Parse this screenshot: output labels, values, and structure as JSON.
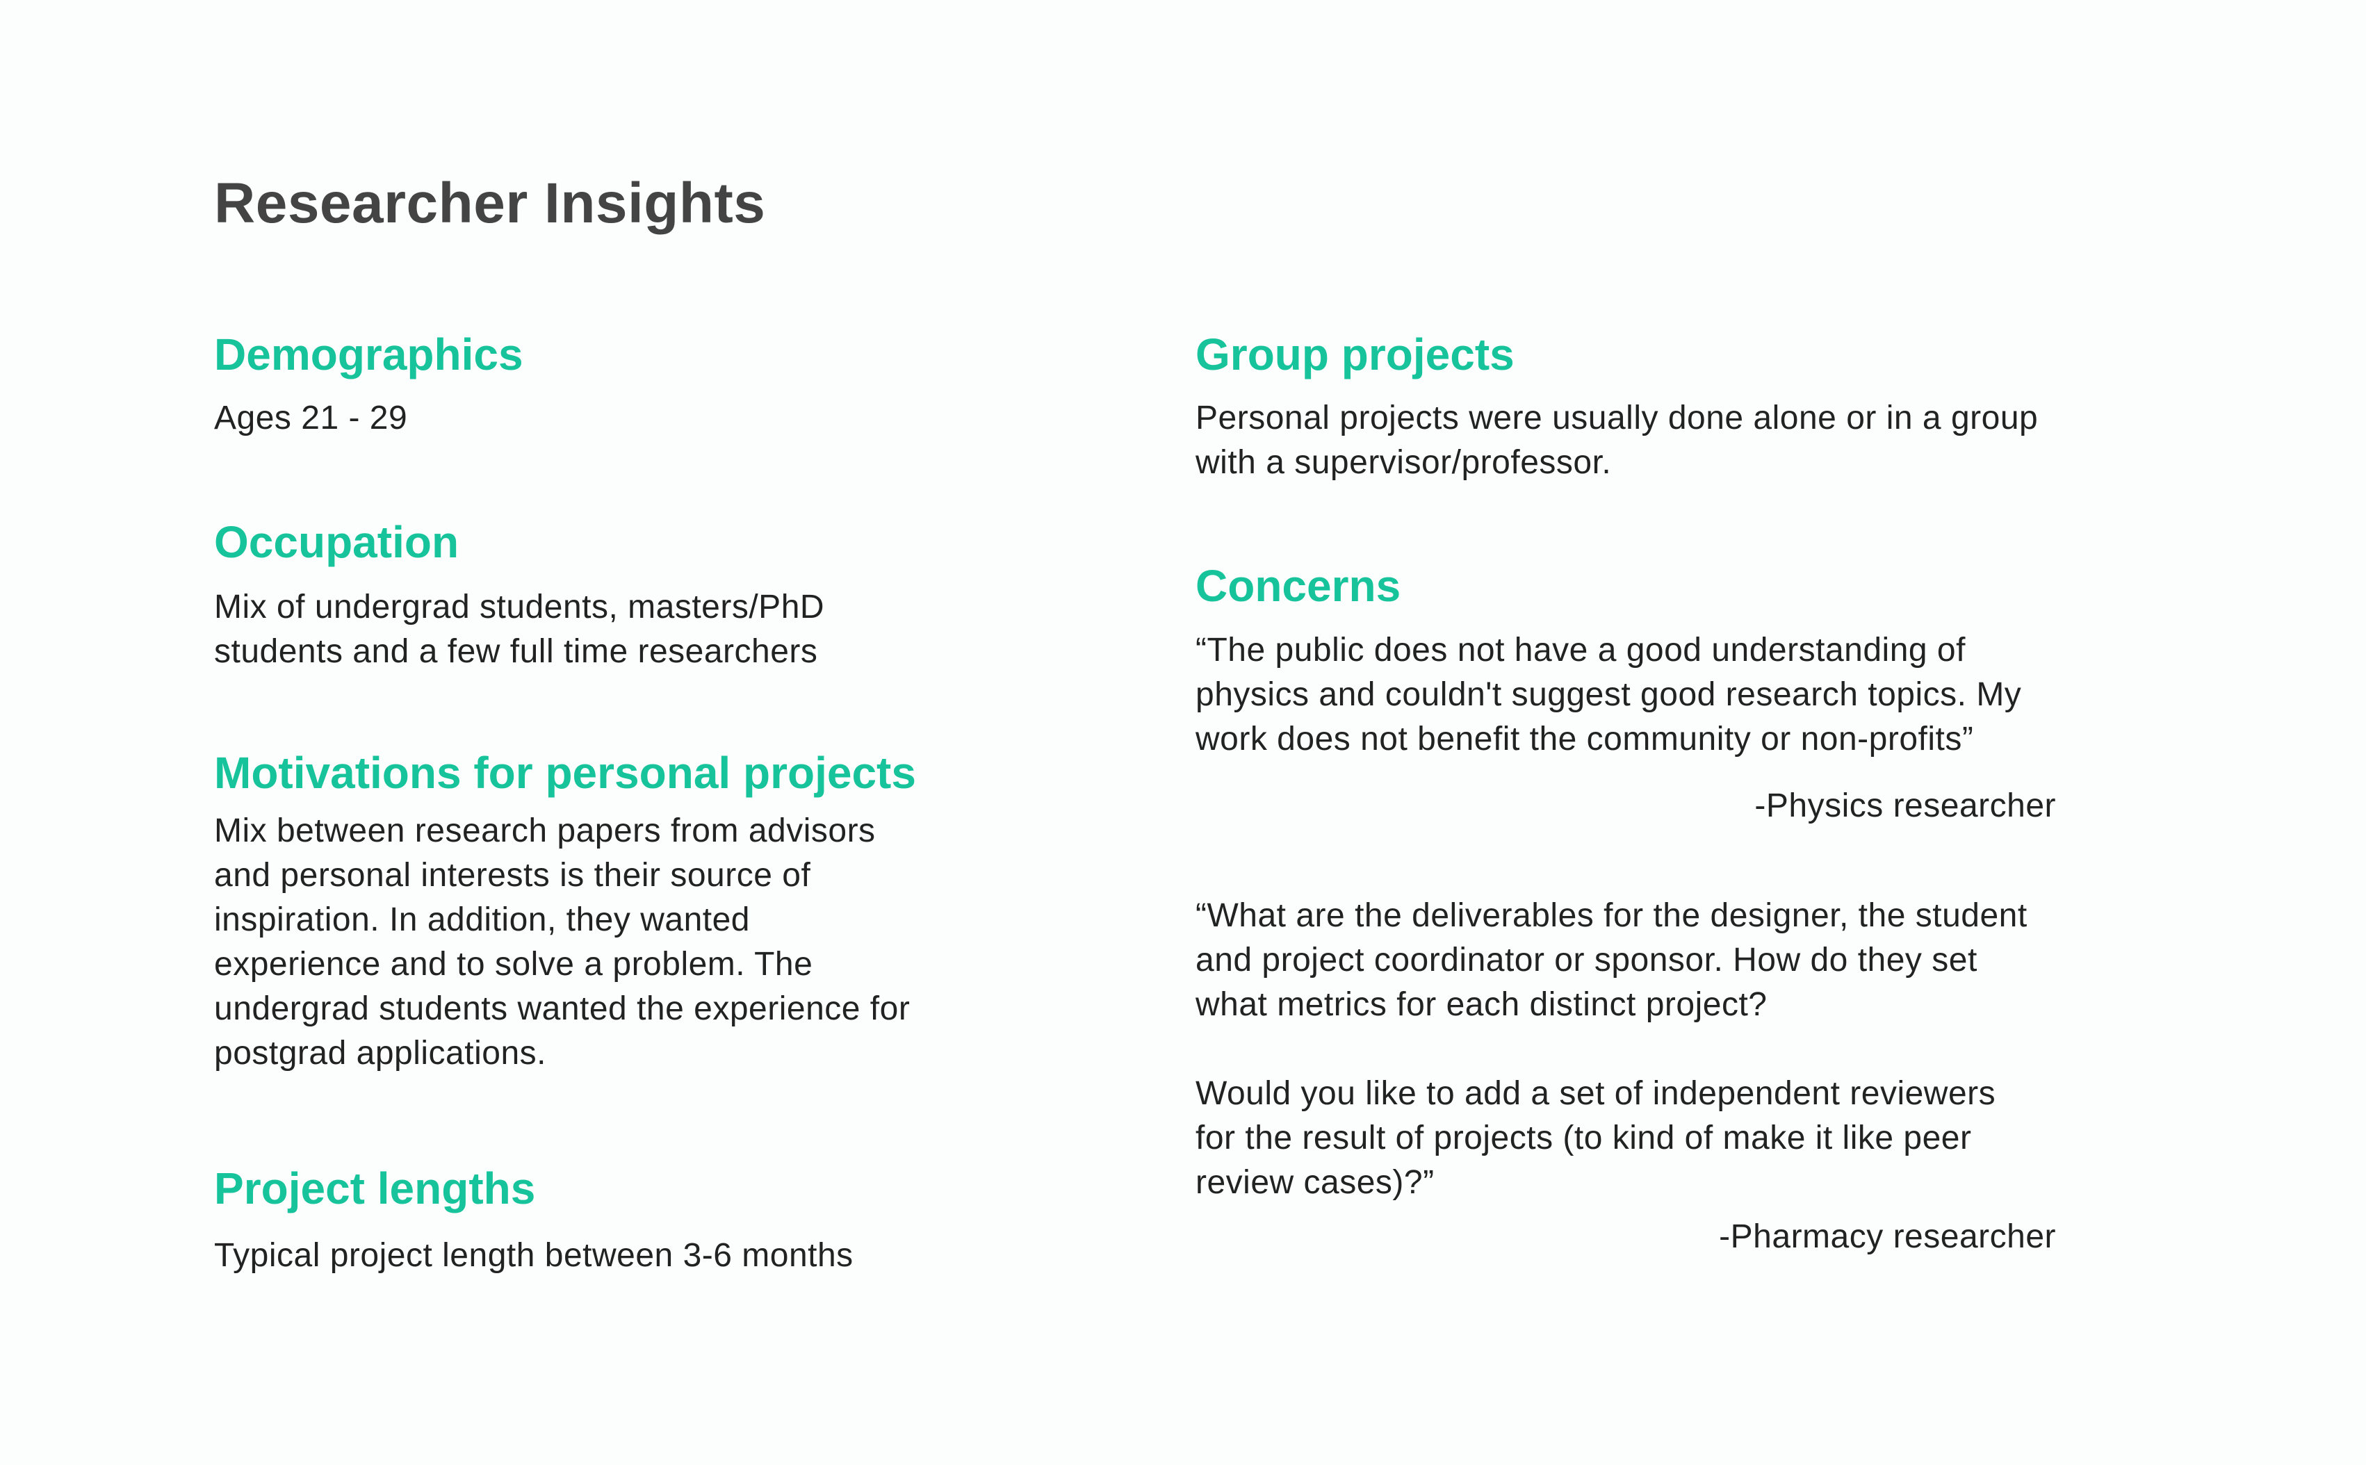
{
  "title": "Researcher Insights",
  "left_column": {
    "demographics": {
      "heading": "Demographics",
      "text": "Ages 21 - 29"
    },
    "occupation": {
      "heading": "Occupation",
      "text": "Mix of undergrad students, masters/PhD\nstudents and a few full time researchers"
    },
    "motivations": {
      "heading": "Motivations for personal projects",
      "text": "Mix between research papers from advisors\nand personal interests is their source of\ninspiration. In addition, they wanted\nexperience and to solve a problem. The\nundergrad students wanted the experience for\npostgrad applications."
    },
    "project_lengths": {
      "heading": "Project lengths",
      "text": "Typical project length between 3-6 months"
    }
  },
  "right_column": {
    "group_projects": {
      "heading": "Group projects",
      "text": "Personal projects were usually done alone or in a group\nwith a supervisor/professor."
    },
    "concerns": {
      "heading": "Concerns",
      "quote_1": "“The public does not have a good understanding of\nphysics and couldn't suggest good research topics. My\nwork does not benefit the community or non-profits”",
      "attribution_1": "-Physics researcher",
      "quote_2": "“What are the deliverables for the designer, the student\nand project coordinator or sponsor. How do they set\nwhat metrics for each distinct project?\n\nWould you like to add a set of independent reviewers\nfor the result of projects (to kind of make it like peer\nreview cases)?”",
      "attribution_2": "-Pharmacy researcher"
    }
  },
  "colors": {
    "accent": "#16c39a",
    "title": "#444444",
    "body": "#222222",
    "background": "#fcfefe"
  }
}
